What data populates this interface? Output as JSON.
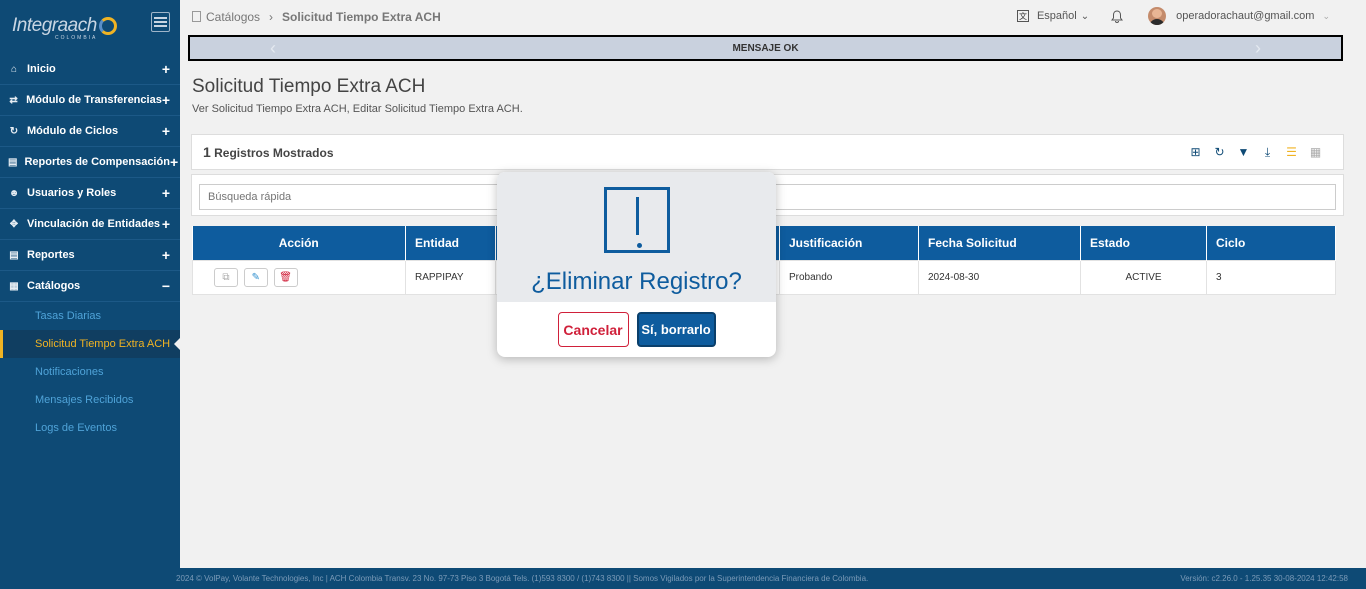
{
  "sidebar": {
    "logo": "Integraach",
    "logo_sub": "COLOMBIA",
    "items": [
      {
        "label": "Inicio",
        "toggle": "+"
      },
      {
        "label": "Módulo de Transferencias",
        "toggle": "+"
      },
      {
        "label": "Módulo de Ciclos",
        "toggle": "+"
      },
      {
        "label": "Reportes de Compensación",
        "toggle": "+"
      },
      {
        "label": "Usuarios y Roles",
        "toggle": "+"
      },
      {
        "label": "Vinculación de Entidades",
        "toggle": "+"
      },
      {
        "label": "Reportes",
        "toggle": "+"
      },
      {
        "label": "Catálogos",
        "toggle": "−"
      }
    ],
    "subitems": [
      "Tasas Diarias",
      "Solicitud Tiempo Extra ACH",
      "Notificaciones",
      "Mensajes Recibidos",
      "Logs de Eventos"
    ],
    "active_subitem": "Solicitud Tiempo Extra ACH"
  },
  "topbar": {
    "breadcrumb": [
      "Catálogos",
      "Solicitud Tiempo Extra ACH"
    ],
    "language": "Español",
    "user": "operadorachaut@gmail.com"
  },
  "message": "MENSAJE OK",
  "page": {
    "title": "Solicitud Tiempo Extra ACH",
    "subtitle": "Ver Solicitud Tiempo Extra ACH, Editar Solicitud Tiempo Extra ACH.",
    "count_number": "1",
    "count_label": "Registros Mostrados",
    "search_placeholder": "Búsqueda rápida"
  },
  "table": {
    "headers": [
      "Acción",
      "Entidad",
      "",
      "Justificación",
      "Fecha Solicitud",
      "Estado",
      "Ciclo"
    ],
    "rows": [
      {
        "entidad": "RAPPIPAY",
        "justificacion": "Probando",
        "fecha": "2024-08-30",
        "estado": "ACTIVE",
        "ciclo": "3"
      }
    ]
  },
  "modal": {
    "title": "¿Eliminar Registro?",
    "cancel_label": "Cancelar",
    "confirm_label": "Sí, borrarlo"
  },
  "footer": {
    "left": "2024 © VolPay, Volante Technologies, Inc | ACH Colombia Transv. 23 No. 97-73 Piso 3 Bogotá Tels. (1)593 8300 / (1)743 8300 || Somos Vigilados por la Superintendencia Financiera de Colombia.",
    "right": "Versión: c2.26.0 - 1.25.35     30-08-2024 12:42:58"
  },
  "colors": {
    "brand": "#0e4a75",
    "accent": "#f0b323",
    "primary": "#0e5c9e",
    "danger": "#d0203a"
  }
}
